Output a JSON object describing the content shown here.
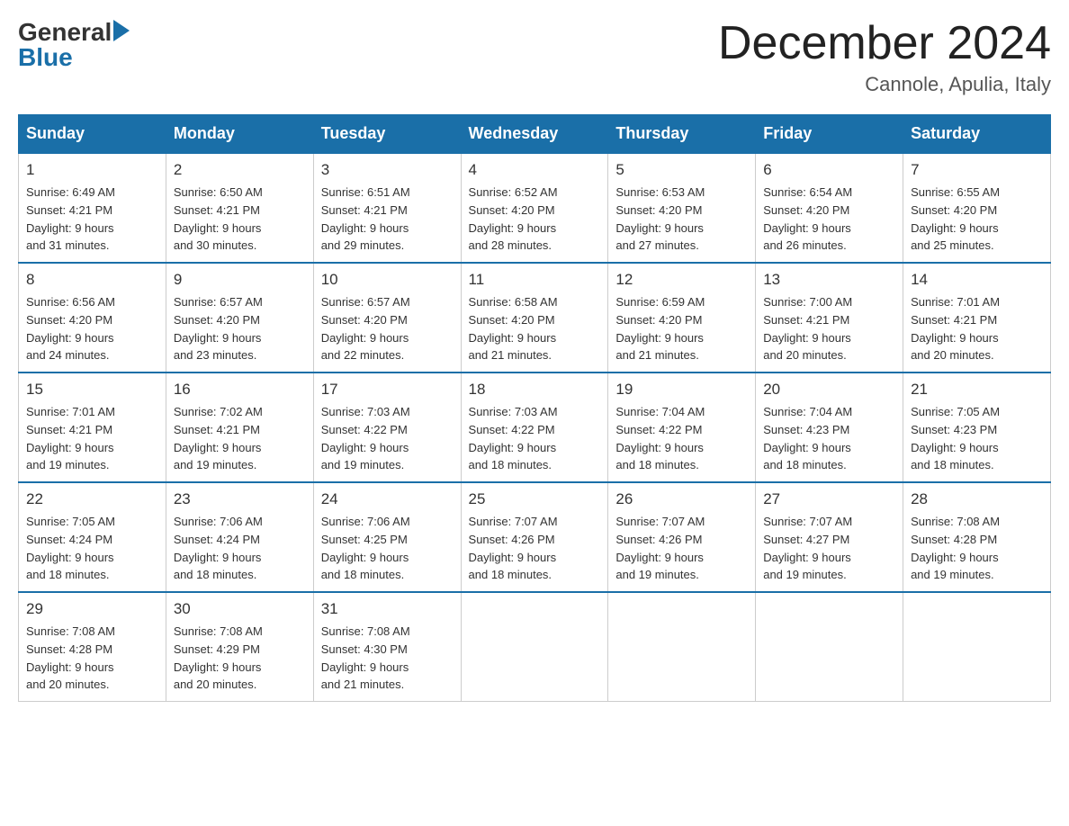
{
  "logo": {
    "general": "General",
    "blue": "Blue"
  },
  "title": "December 2024",
  "location": "Cannole, Apulia, Italy",
  "days_of_week": [
    "Sunday",
    "Monday",
    "Tuesday",
    "Wednesday",
    "Thursday",
    "Friday",
    "Saturday"
  ],
  "weeks": [
    [
      {
        "day": "1",
        "sunrise": "6:49 AM",
        "sunset": "4:21 PM",
        "daylight": "9 hours and 31 minutes."
      },
      {
        "day": "2",
        "sunrise": "6:50 AM",
        "sunset": "4:21 PM",
        "daylight": "9 hours and 30 minutes."
      },
      {
        "day": "3",
        "sunrise": "6:51 AM",
        "sunset": "4:21 PM",
        "daylight": "9 hours and 29 minutes."
      },
      {
        "day": "4",
        "sunrise": "6:52 AM",
        "sunset": "4:20 PM",
        "daylight": "9 hours and 28 minutes."
      },
      {
        "day": "5",
        "sunrise": "6:53 AM",
        "sunset": "4:20 PM",
        "daylight": "9 hours and 27 minutes."
      },
      {
        "day": "6",
        "sunrise": "6:54 AM",
        "sunset": "4:20 PM",
        "daylight": "9 hours and 26 minutes."
      },
      {
        "day": "7",
        "sunrise": "6:55 AM",
        "sunset": "4:20 PM",
        "daylight": "9 hours and 25 minutes."
      }
    ],
    [
      {
        "day": "8",
        "sunrise": "6:56 AM",
        "sunset": "4:20 PM",
        "daylight": "9 hours and 24 minutes."
      },
      {
        "day": "9",
        "sunrise": "6:57 AM",
        "sunset": "4:20 PM",
        "daylight": "9 hours and 23 minutes."
      },
      {
        "day": "10",
        "sunrise": "6:57 AM",
        "sunset": "4:20 PM",
        "daylight": "9 hours and 22 minutes."
      },
      {
        "day": "11",
        "sunrise": "6:58 AM",
        "sunset": "4:20 PM",
        "daylight": "9 hours and 21 minutes."
      },
      {
        "day": "12",
        "sunrise": "6:59 AM",
        "sunset": "4:20 PM",
        "daylight": "9 hours and 21 minutes."
      },
      {
        "day": "13",
        "sunrise": "7:00 AM",
        "sunset": "4:21 PM",
        "daylight": "9 hours and 20 minutes."
      },
      {
        "day": "14",
        "sunrise": "7:01 AM",
        "sunset": "4:21 PM",
        "daylight": "9 hours and 20 minutes."
      }
    ],
    [
      {
        "day": "15",
        "sunrise": "7:01 AM",
        "sunset": "4:21 PM",
        "daylight": "9 hours and 19 minutes."
      },
      {
        "day": "16",
        "sunrise": "7:02 AM",
        "sunset": "4:21 PM",
        "daylight": "9 hours and 19 minutes."
      },
      {
        "day": "17",
        "sunrise": "7:03 AM",
        "sunset": "4:22 PM",
        "daylight": "9 hours and 19 minutes."
      },
      {
        "day": "18",
        "sunrise": "7:03 AM",
        "sunset": "4:22 PM",
        "daylight": "9 hours and 18 minutes."
      },
      {
        "day": "19",
        "sunrise": "7:04 AM",
        "sunset": "4:22 PM",
        "daylight": "9 hours and 18 minutes."
      },
      {
        "day": "20",
        "sunrise": "7:04 AM",
        "sunset": "4:23 PM",
        "daylight": "9 hours and 18 minutes."
      },
      {
        "day": "21",
        "sunrise": "7:05 AM",
        "sunset": "4:23 PM",
        "daylight": "9 hours and 18 minutes."
      }
    ],
    [
      {
        "day": "22",
        "sunrise": "7:05 AM",
        "sunset": "4:24 PM",
        "daylight": "9 hours and 18 minutes."
      },
      {
        "day": "23",
        "sunrise": "7:06 AM",
        "sunset": "4:24 PM",
        "daylight": "9 hours and 18 minutes."
      },
      {
        "day": "24",
        "sunrise": "7:06 AM",
        "sunset": "4:25 PM",
        "daylight": "9 hours and 18 minutes."
      },
      {
        "day": "25",
        "sunrise": "7:07 AM",
        "sunset": "4:26 PM",
        "daylight": "9 hours and 18 minutes."
      },
      {
        "day": "26",
        "sunrise": "7:07 AM",
        "sunset": "4:26 PM",
        "daylight": "9 hours and 19 minutes."
      },
      {
        "day": "27",
        "sunrise": "7:07 AM",
        "sunset": "4:27 PM",
        "daylight": "9 hours and 19 minutes."
      },
      {
        "day": "28",
        "sunrise": "7:08 AM",
        "sunset": "4:28 PM",
        "daylight": "9 hours and 19 minutes."
      }
    ],
    [
      {
        "day": "29",
        "sunrise": "7:08 AM",
        "sunset": "4:28 PM",
        "daylight": "9 hours and 20 minutes."
      },
      {
        "day": "30",
        "sunrise": "7:08 AM",
        "sunset": "4:29 PM",
        "daylight": "9 hours and 20 minutes."
      },
      {
        "day": "31",
        "sunrise": "7:08 AM",
        "sunset": "4:30 PM",
        "daylight": "9 hours and 21 minutes."
      },
      null,
      null,
      null,
      null
    ]
  ],
  "labels": {
    "sunrise": "Sunrise:",
    "sunset": "Sunset:",
    "daylight": "Daylight:"
  }
}
